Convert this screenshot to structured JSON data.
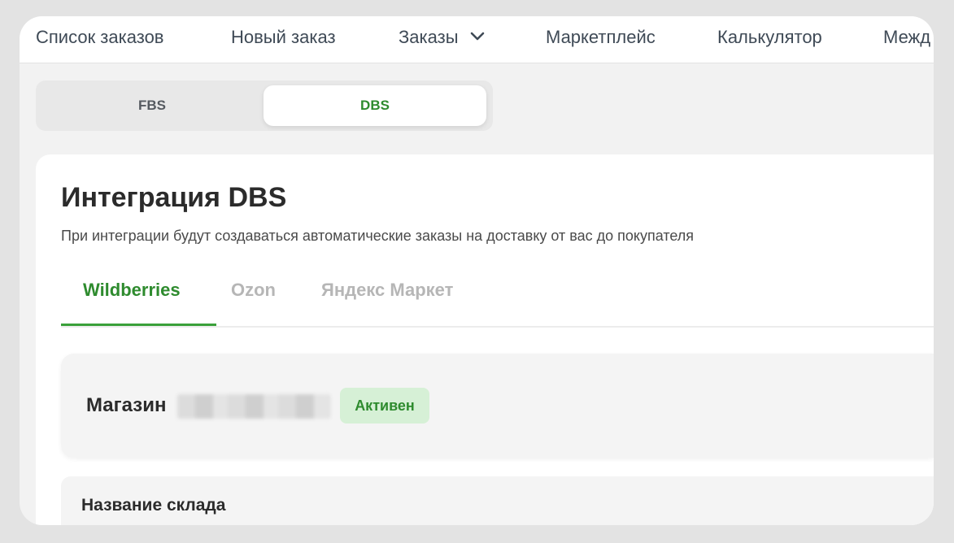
{
  "nav": {
    "items": [
      "Список заказов",
      "Новый заказ",
      "Заказы",
      "Маркетплейс",
      "Калькулятор",
      "Межд"
    ]
  },
  "segmented": {
    "fbs_label": "FBS",
    "dbs_label": "DBS",
    "selected": "DBS"
  },
  "integration": {
    "title": "Интеграция DBS",
    "subtitle": "При интеграции будут создаваться автоматические заказы на доставку от вас до покупателя",
    "tabs": [
      "Wildberries",
      "Ozon",
      "Яндекс Маркет"
    ],
    "active_tab": "Wildberries"
  },
  "shop": {
    "label": "Магазин",
    "status": "Активен"
  },
  "warehouse": {
    "label": "Название склада"
  },
  "colors": {
    "accent_green": "#2e8b2e",
    "badge_bg": "#d6f0d6"
  }
}
